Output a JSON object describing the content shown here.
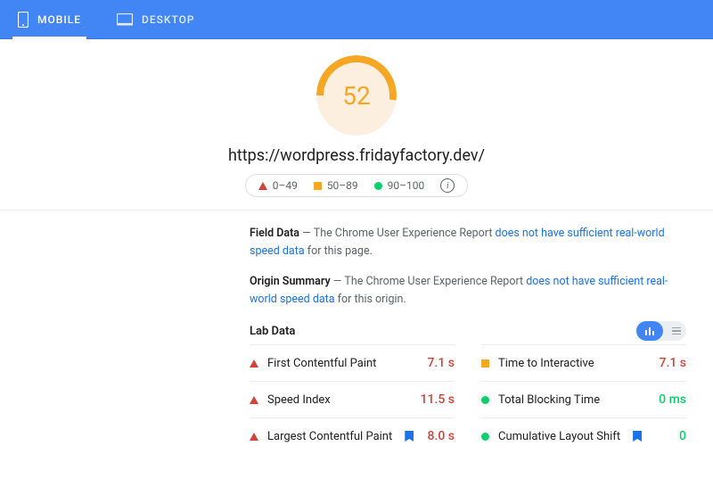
{
  "tabs": {
    "mobile": "MOBILE",
    "desktop": "DESKTOP"
  },
  "score": 52,
  "url": "https://wordpress.fridayfactory.dev/",
  "legend": {
    "poor": "0–49",
    "avg": "50–89",
    "good": "90–100"
  },
  "field": {
    "label": "Field Data",
    "prefix": " — The Chrome User Experience Report ",
    "link": "does not have sufficient real-world speed data",
    "suffix": " for this page."
  },
  "origin": {
    "label": "Origin Summary",
    "prefix": " — The Chrome User Experience Report ",
    "link": "does not have sufficient real-world speed data",
    "suffix": " for this origin."
  },
  "lab": {
    "title": "Lab Data"
  },
  "metrics": {
    "fcp": {
      "label": "First Contentful Paint",
      "value": "7.1 s"
    },
    "si": {
      "label": "Speed Index",
      "value": "11.5 s"
    },
    "lcp": {
      "label": "Largest Contentful Paint",
      "value": "8.0 s"
    },
    "tti": {
      "label": "Time to Interactive",
      "value": "7.1 s"
    },
    "tbt": {
      "label": "Total Blocking Time",
      "value": "0 ms"
    },
    "cls": {
      "label": "Cumulative Layout Shift",
      "value": "0"
    }
  }
}
